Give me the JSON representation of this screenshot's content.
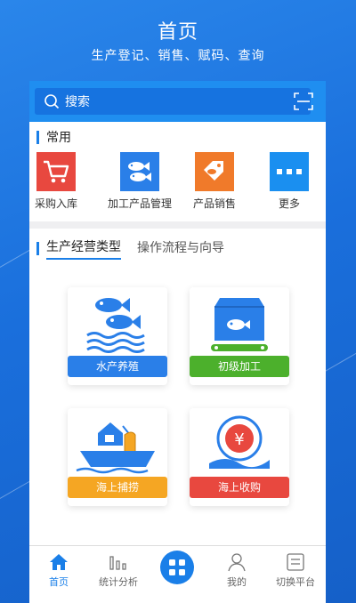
{
  "header": {
    "title": "首页",
    "subtitle": "生产登记、销售、赋码、查询"
  },
  "search": {
    "placeholder": "搜索"
  },
  "common": {
    "heading": "常用",
    "items": [
      {
        "label": "采购入库",
        "icon": "cart-icon",
        "color": "#e8483f"
      },
      {
        "label": "加工产品管理",
        "icon": "fish-icon",
        "color": "#2a7fe8"
      },
      {
        "label": "产品销售",
        "icon": "tag-fish-icon",
        "color": "#f07a2a"
      },
      {
        "label": "更多",
        "icon": "more-icon",
        "color": "#1a8ff0"
      }
    ]
  },
  "tabs": [
    {
      "label": "生产经营类型",
      "active": true
    },
    {
      "label": "操作流程与向导",
      "active": false
    }
  ],
  "types": [
    {
      "label": "水产养殖",
      "icon": "fish-farming-icon",
      "color": "#2a7fe8"
    },
    {
      "label": "初级加工",
      "icon": "processing-box-icon",
      "color": "#4cb02c"
    },
    {
      "label": "海上捕捞",
      "icon": "fishing-boat-icon",
      "color": "#f5a623"
    },
    {
      "label": "海上收购",
      "icon": "yuan-hand-icon",
      "color": "#e8483f"
    }
  ],
  "nav": [
    {
      "label": "首页",
      "icon": "home-icon",
      "active": true
    },
    {
      "label": "统计分析",
      "icon": "bar-chart-icon",
      "active": false
    },
    {
      "label": "",
      "icon": "apps-grid-icon",
      "active": false
    },
    {
      "label": "我的",
      "icon": "user-icon",
      "active": false
    },
    {
      "label": "切换平台",
      "icon": "switch-platform-icon",
      "active": false
    }
  ]
}
